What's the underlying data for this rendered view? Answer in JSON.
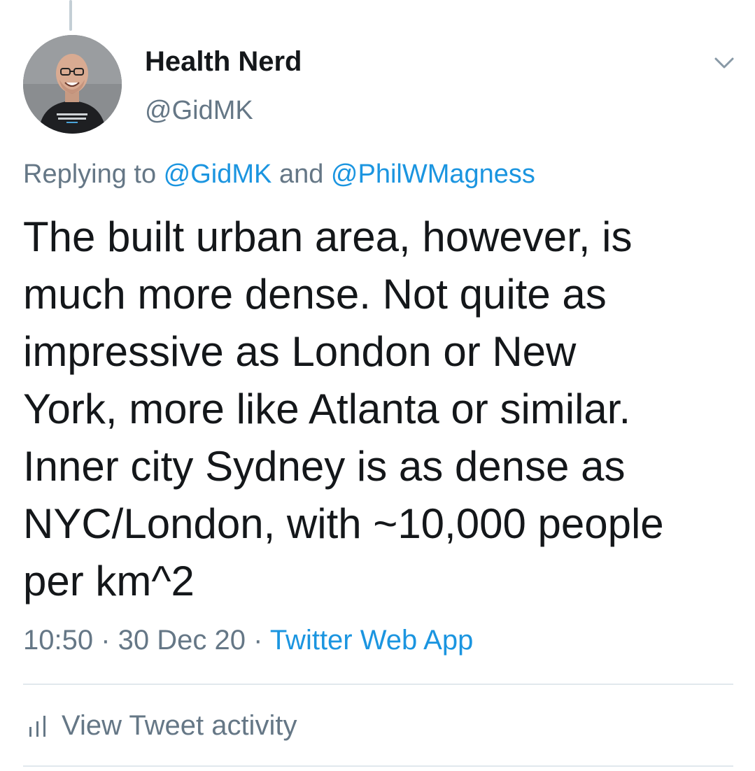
{
  "author": {
    "display_name": "Health Nerd",
    "handle": "@GidMK",
    "avatar_icon": "profile-photo"
  },
  "reply": {
    "prefix": "Replying to ",
    "mention1": "@GidMK",
    "conjunction": " and ",
    "mention2": "@PhilWMagness"
  },
  "tweet": {
    "text": "The built urban area, however, is\nmuch more dense. Not quite as\nimpressive as London or New\nYork, more like Atlanta or similar.\nInner city Sydney is as dense as\nNYC/London, with ~10,000 people\nper km^2"
  },
  "meta": {
    "time": "10:50",
    "separator1": " · ",
    "date": "30 Dec 20",
    "separator2": " · ",
    "source": "Twitter Web App"
  },
  "activity": {
    "label": "View Tweet activity",
    "icon": "bar-chart-icon"
  },
  "colors": {
    "text": "#14171a",
    "secondary": "#657786",
    "link": "#1b95e0",
    "divider": "#e1e8ed"
  }
}
